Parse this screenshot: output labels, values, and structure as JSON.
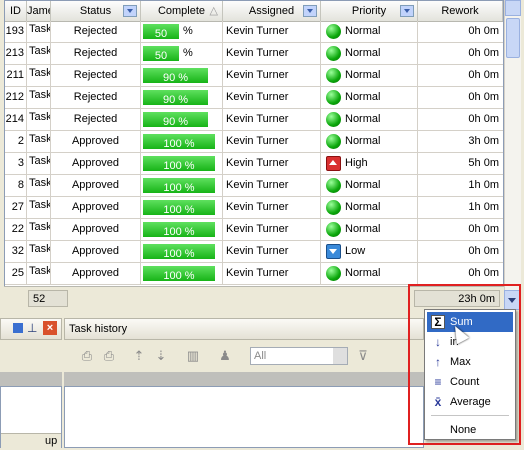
{
  "grid": {
    "headers": [
      {
        "label": "ID",
        "drop": false
      },
      {
        "label": "Jame",
        "drop": false
      },
      {
        "label": "Status",
        "drop": true
      },
      {
        "label": "Complete",
        "drop": false,
        "sort": "△"
      },
      {
        "label": "Assigned",
        "drop": true
      },
      {
        "label": "Priority",
        "drop": true
      },
      {
        "label": "Rework",
        "drop": false
      }
    ],
    "rows": [
      {
        "id": "193",
        "name": "Task",
        "status": "Rejected",
        "complete": 50,
        "complete_label": "50",
        "unit": "%",
        "assigned": "Kevin Turner",
        "priority": "Normal",
        "rework": "0h 0m"
      },
      {
        "id": "213",
        "name": "Task",
        "status": "Rejected",
        "complete": 50,
        "complete_label": "50",
        "unit": "%",
        "assigned": "Kevin Turner",
        "priority": "Normal",
        "rework": "0h 0m"
      },
      {
        "id": "211",
        "name": "Task",
        "status": "Rejected",
        "complete": 90,
        "complete_label": "90 %",
        "unit": "",
        "assigned": "Kevin Turner",
        "priority": "Normal",
        "rework": "0h 0m"
      },
      {
        "id": "212",
        "name": "Task",
        "status": "Rejected",
        "complete": 90,
        "complete_label": "90 %",
        "unit": "",
        "assigned": "Kevin Turner",
        "priority": "Normal",
        "rework": "0h 0m"
      },
      {
        "id": "214",
        "name": "Task",
        "status": "Rejected",
        "complete": 90,
        "complete_label": "90 %",
        "unit": "",
        "assigned": "Kevin Turner",
        "priority": "Normal",
        "rework": "0h 0m"
      },
      {
        "id": "2",
        "name": "Task",
        "status": "Approved",
        "complete": 100,
        "complete_label": "100 %",
        "unit": "",
        "assigned": "Kevin Turner",
        "priority": "Normal",
        "rework": "3h 0m"
      },
      {
        "id": "3",
        "name": "Task",
        "status": "Approved",
        "complete": 100,
        "complete_label": "100 %",
        "unit": "",
        "assigned": "Kevin Turner",
        "priority": "High",
        "rework": "5h 0m"
      },
      {
        "id": "8",
        "name": "Task",
        "status": "Approved",
        "complete": 100,
        "complete_label": "100 %",
        "unit": "",
        "assigned": "Kevin Turner",
        "priority": "Normal",
        "rework": "1h 0m"
      },
      {
        "id": "27",
        "name": "Task",
        "status": "Approved",
        "complete": 100,
        "complete_label": "100 %",
        "unit": "",
        "assigned": "Kevin Turner",
        "priority": "Normal",
        "rework": "1h 0m"
      },
      {
        "id": "22",
        "name": "Task",
        "status": "Approved",
        "complete": 100,
        "complete_label": "100 %",
        "unit": "",
        "assigned": "Kevin Turner",
        "priority": "Normal",
        "rework": "0h 0m"
      },
      {
        "id": "32",
        "name": "Task",
        "status": "Approved",
        "complete": 100,
        "complete_label": "100 %",
        "unit": "",
        "assigned": "Kevin Turner",
        "priority": "Low",
        "rework": "0h 0m"
      },
      {
        "id": "25",
        "name": "Task",
        "status": "Approved",
        "complete": 100,
        "complete_label": "100 %",
        "unit": "",
        "assigned": "Kevin Turner",
        "priority": "Normal",
        "rework": "0h 0m"
      }
    ],
    "footer": {
      "count": "52",
      "rework_total": "23h 0m"
    }
  },
  "lower_panel": {
    "title": "Task history",
    "filter_combo": "All",
    "left_label": "up"
  },
  "summary_menu": {
    "items": [
      {
        "icon": "sum-icon",
        "glyph": "Σ",
        "label": "Sum",
        "selected": true
      },
      {
        "icon": "min-icon",
        "glyph": "↓",
        "label": "in",
        "selected": false
      },
      {
        "icon": "max-icon",
        "glyph": "↑",
        "label": "Max",
        "selected": false
      },
      {
        "icon": "count-icon",
        "glyph": "≡",
        "label": "Count",
        "selected": false
      },
      {
        "icon": "average-icon",
        "glyph": "x̄",
        "label": "Average",
        "selected": false
      },
      {
        "icon": "none-icon",
        "glyph": "",
        "label": "None",
        "selected": false
      }
    ]
  },
  "colors": {
    "accent": "#316ac5",
    "progress": "#1fbf1f",
    "highlight_box": "#e02020"
  }
}
